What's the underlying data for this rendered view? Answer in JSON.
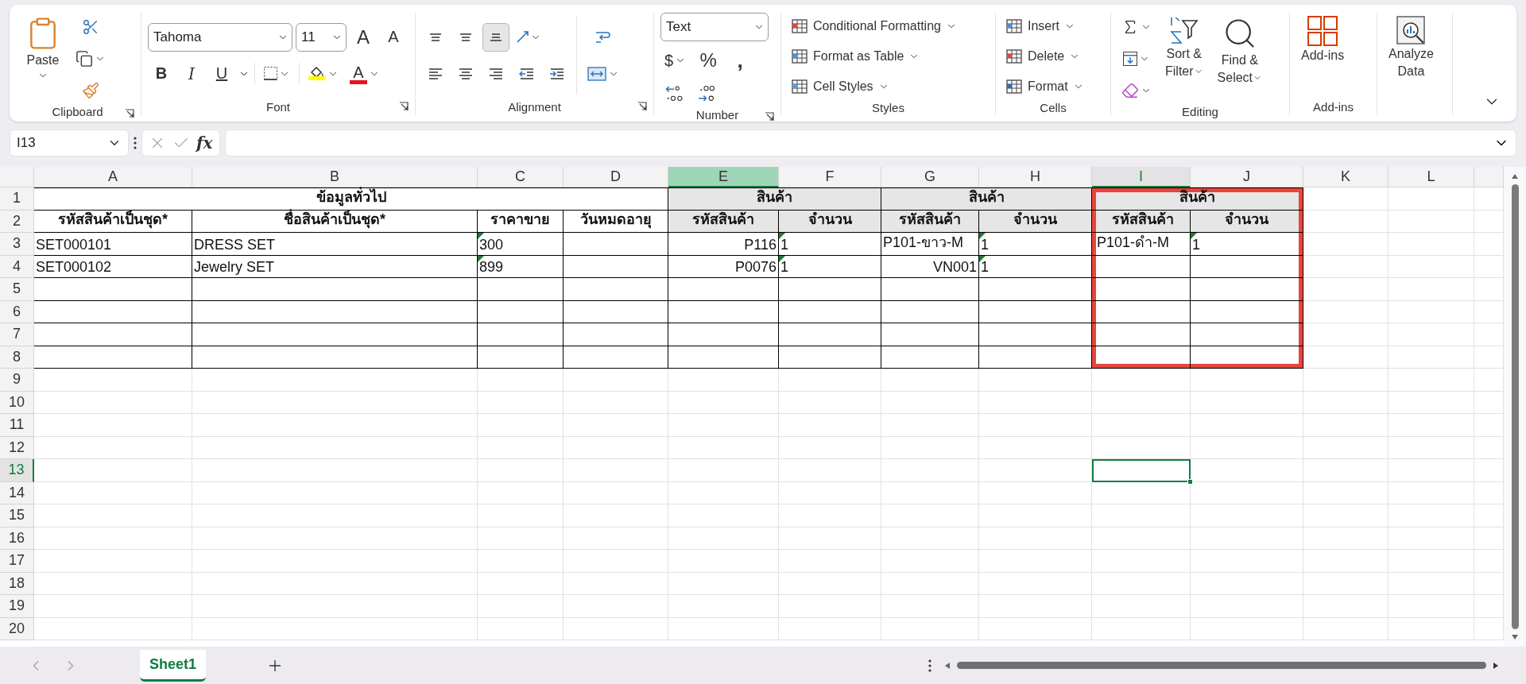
{
  "ribbon": {
    "clipboard": {
      "label": "Clipboard",
      "paste": "Paste"
    },
    "font": {
      "label": "Font",
      "font_name": "Tahoma",
      "font_size": "11",
      "grow": "A",
      "shrink": "A",
      "bold": "B",
      "italic": "I",
      "underline": "U",
      "font_color": "A"
    },
    "alignment": {
      "label": "Alignment",
      "vertical": [
        {
          "selected": false
        },
        {
          "selected": false
        },
        {
          "selected": true
        }
      ]
    },
    "number": {
      "label": "Number",
      "format": "Text",
      "currency": "$",
      "percent": "%",
      "comma": ","
    },
    "styles": {
      "label": "Styles",
      "items": [
        "Conditional Formatting",
        "Format as Table",
        "Cell Styles"
      ]
    },
    "cells": {
      "label": "Cells",
      "items": [
        "Insert",
        "Delete",
        "Format"
      ]
    },
    "editing": {
      "label": "Editing",
      "sort": [
        "Sort &",
        "Filter"
      ],
      "find": [
        "Find &",
        "Select"
      ]
    },
    "addins": {
      "label": "Add-ins",
      "button": "Add-ins"
    },
    "analyze": {
      "button": [
        "Analyze",
        "Data"
      ]
    }
  },
  "formula_bar": {
    "name_box": "I13",
    "fx": "fx"
  },
  "sheet": {
    "columns": [
      {
        "letter": "A",
        "selected": false,
        "highlighted": false
      },
      {
        "letter": "B",
        "selected": false,
        "highlighted": false
      },
      {
        "letter": "C",
        "selected": false,
        "highlighted": false
      },
      {
        "letter": "D",
        "selected": false,
        "highlighted": false
      },
      {
        "letter": "E",
        "selected": false,
        "highlighted": true
      },
      {
        "letter": "F",
        "selected": false,
        "highlighted": false
      },
      {
        "letter": "G",
        "selected": false,
        "highlighted": false
      },
      {
        "letter": "H",
        "selected": false,
        "highlighted": false
      },
      {
        "letter": "I",
        "selected": true,
        "highlighted": false
      },
      {
        "letter": "J",
        "selected": false,
        "highlighted": false
      },
      {
        "letter": "K",
        "selected": false,
        "highlighted": false
      },
      {
        "letter": "L",
        "selected": false,
        "highlighted": false
      }
    ],
    "rows": [
      {
        "number": "1",
        "selected": false
      },
      {
        "number": "2",
        "selected": false
      },
      {
        "number": "3",
        "selected": false
      },
      {
        "number": "4",
        "selected": false
      },
      {
        "number": "5",
        "selected": false
      },
      {
        "number": "6",
        "selected": false
      },
      {
        "number": "7",
        "selected": false
      },
      {
        "number": "8",
        "selected": false
      },
      {
        "number": "9",
        "selected": false
      },
      {
        "number": "10",
        "selected": false
      },
      {
        "number": "11",
        "selected": false
      },
      {
        "number": "12",
        "selected": false
      },
      {
        "number": "13",
        "selected": true
      },
      {
        "number": "14",
        "selected": false
      },
      {
        "number": "15",
        "selected": false
      },
      {
        "number": "16",
        "selected": false
      },
      {
        "number": "17",
        "selected": false
      },
      {
        "number": "18",
        "selected": false
      },
      {
        "number": "19",
        "selected": false
      },
      {
        "number": "20",
        "selected": false
      }
    ],
    "table": {
      "groups": [
        {
          "title": "ข้อมูลทั่วไป",
          "shaded": false,
          "framed": false,
          "headers": [
            {
              "text": "รหัสสินค้าเป็นชุด*"
            },
            {
              "text": "ชื่อสินค้าเป็นชุด*"
            },
            {
              "text": "ราคาขาย"
            },
            {
              "text": "วันหมดอายุ"
            }
          ]
        },
        {
          "title": "สินค้า",
          "shaded": true,
          "framed": false,
          "headers": [
            {
              "text": "รหัสสินค้า"
            },
            {
              "text": "จำนวน"
            }
          ]
        },
        {
          "title": "สินค้า",
          "shaded": true,
          "framed": false,
          "headers": [
            {
              "text": "รหัสสินค้า"
            },
            {
              "text": "จำนวน"
            }
          ]
        },
        {
          "title": "สินค้า",
          "shaded": true,
          "framed": true,
          "headers": [
            {
              "text": "รหัสสินค้า"
            },
            {
              "text": "จำนวน"
            }
          ]
        }
      ],
      "rows": [
        {
          "cells": [
            {
              "text": "SET000101",
              "right_aligned": false,
              "flag": false
            },
            {
              "text": "DRESS SET",
              "right_aligned": false,
              "flag": false
            },
            {
              "text": "300",
              "right_aligned": false,
              "flag": true
            },
            {},
            {
              "text": "P116",
              "right_aligned": true,
              "flag": false
            },
            {
              "text": "1",
              "right_aligned": false,
              "flag": true
            },
            {
              "text": "P101-ขาว-M",
              "right_aligned": false,
              "flag": false
            },
            {
              "text": "1",
              "right_aligned": false,
              "flag": true
            },
            {
              "text": "P101-ดำ-M",
              "right_aligned": false,
              "flag": false
            },
            {
              "text": "1",
              "right_aligned": false,
              "flag": true
            }
          ]
        },
        {
          "cells": [
            {
              "text": "SET000102",
              "right_aligned": false,
              "flag": false
            },
            {
              "text": "Jewelry SET",
              "right_aligned": false,
              "flag": false
            },
            {
              "text": "899",
              "right_aligned": false,
              "flag": true
            },
            {},
            {
              "text": "P0076",
              "right_aligned": true,
              "flag": false
            },
            {
              "text": "1",
              "right_aligned": false,
              "flag": true
            },
            {
              "text": "VN001",
              "right_aligned": true,
              "flag": false
            },
            {
              "text": "1",
              "right_aligned": false,
              "flag": true
            },
            {},
            {}
          ]
        },
        {
          "cells": [
            {},
            {},
            {},
            {},
            {},
            {},
            {},
            {},
            {},
            {}
          ]
        },
        {
          "cells": [
            {},
            {},
            {},
            {},
            {},
            {},
            {},
            {},
            {},
            {}
          ]
        },
        {
          "cells": [
            {},
            {},
            {},
            {},
            {},
            {},
            {},
            {},
            {},
            {}
          ]
        },
        {
          "cells": [
            {},
            {},
            {},
            {},
            {},
            {},
            {},
            {},
            {},
            {}
          ]
        }
      ]
    }
  },
  "sheet_tabs": [
    {
      "label": "Sheet1",
      "selected": true
    }
  ]
}
